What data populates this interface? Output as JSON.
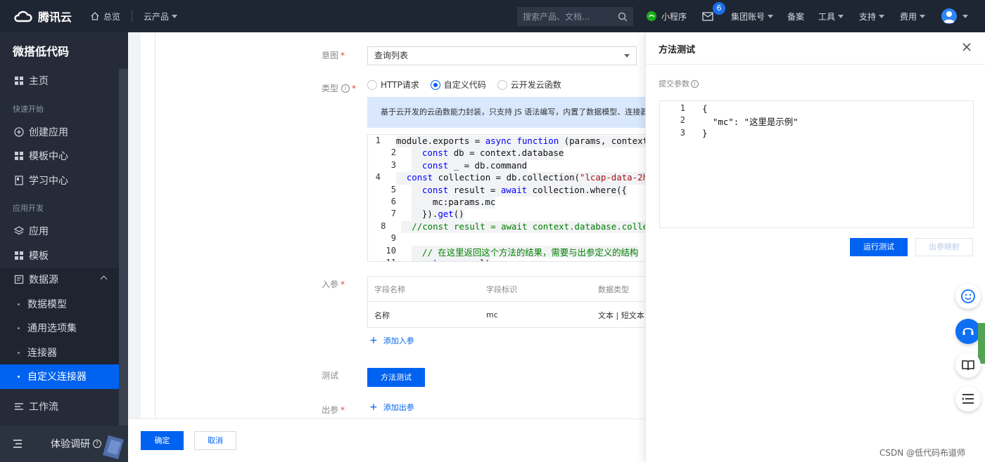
{
  "topbar": {
    "logo_text": "腾讯云",
    "overview": "总览",
    "products": "云产品",
    "search_placeholder": "搜索产品、文档...",
    "mini_program": "小程序",
    "mail_badge": "6",
    "group_account": "集团账号",
    "filing": "备案",
    "tools": "工具",
    "support": "支持",
    "billing": "费用"
  },
  "sidebar": {
    "title": "微搭低代码",
    "home": "主页",
    "group_quickstart": "快速开始",
    "create_app": "创建应用",
    "template_center": "模板中心",
    "learning_center": "学习中心",
    "group_appdev": "应用开发",
    "apps": "应用",
    "templates": "模板",
    "datasource": "数据源",
    "data_model": "数据模型",
    "common_options": "通用选项集",
    "connector": "连接器",
    "custom_connector": "自定义连接器",
    "workflow": "工作流",
    "footer_label": "体验调研"
  },
  "form": {
    "intent_label": "意图",
    "intent_value": "查询列表",
    "type_label": "类型",
    "type_options": [
      "HTTP请求",
      "自定义代码",
      "云开发云函数"
    ],
    "type_selected": "自定义代码",
    "info_text": "基于云开发的云函数能力封装，只支持 JS 语法编写，内置了数据模型、连接器",
    "code_lines": [
      {
        "n": "1",
        "t": "module.exports = async function (params, context"
      },
      {
        "n": "2",
        "t": "  const db = context.database"
      },
      {
        "n": "3",
        "t": "  const _ = db.command"
      },
      {
        "n": "4",
        "t": "  const collection = db.collection(\"lcap-data-2h"
      },
      {
        "n": "5",
        "t": "  const result = await collection.where({"
      },
      {
        "n": "6",
        "t": "    mc:params.mc"
      },
      {
        "n": "7",
        "t": "  }).get()"
      },
      {
        "n": "8",
        "t": "  //const result = await context.database.colle"
      },
      {
        "n": "9",
        "t": ""
      },
      {
        "n": "10",
        "t": "  // 在这里返回这个方法的结果，需要与出参定义的结构"
      },
      {
        "n": "11",
        "t": "  return result"
      }
    ],
    "input_label": "入参",
    "table_headers": [
      "字段名称",
      "字段标识",
      "数据类型"
    ],
    "table_row": [
      "名称",
      "mc",
      "文本 | 短文本"
    ],
    "add_input": "添加入参",
    "test_label": "测试",
    "test_button": "方法测试",
    "output_label": "出参",
    "add_output": "添加出参",
    "confirm": "确定",
    "cancel": "取消"
  },
  "drawer": {
    "title": "方法测试",
    "param_label": "提交参数",
    "editor_lines": [
      {
        "n": "1",
        "t": "{"
      },
      {
        "n": "2",
        "t": "  \"mc\": \"这里是示例\""
      },
      {
        "n": "3",
        "t": "}"
      }
    ],
    "run_test": "运行测试",
    "output_mapping": "出参映射"
  },
  "watermark": "CSDN @低代码布道师",
  "colors": {
    "primary": "#0062f0",
    "topbar": "#1f2633",
    "sidebar": "#252b38"
  }
}
